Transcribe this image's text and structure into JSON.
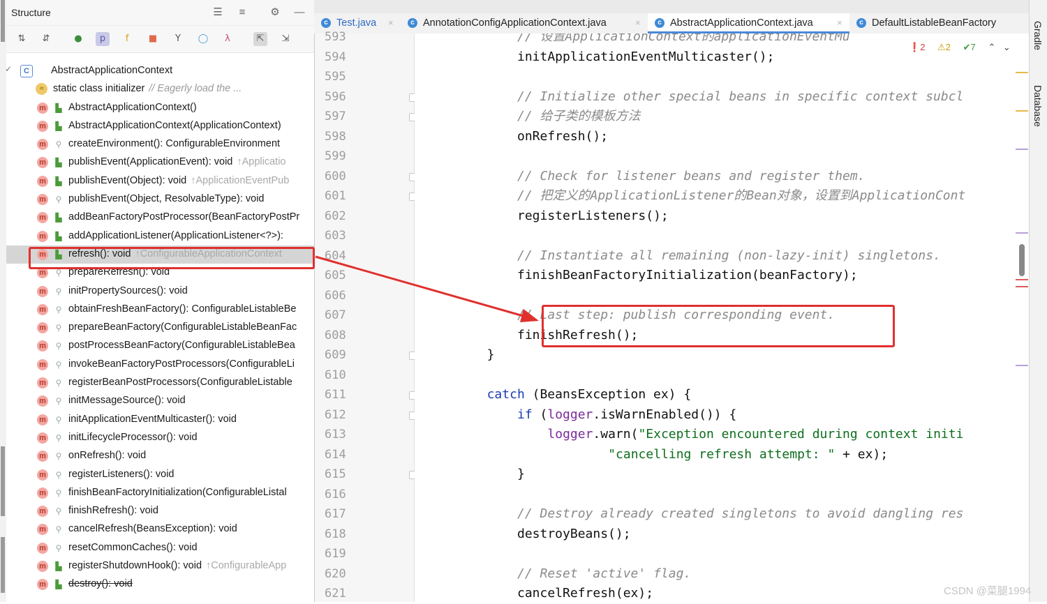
{
  "structure": {
    "title": "Structure",
    "root": "AbstractApplicationContext",
    "items": [
      {
        "badge": "",
        "text": "static class initializer",
        "hint": "// Eagerly load the ...",
        "kind": "init"
      },
      {
        "badge": "m",
        "text": "AbstractApplicationContext()",
        "hint": "",
        "kind": "pub"
      },
      {
        "badge": "m",
        "text": "AbstractApplicationContext(ApplicationContext)",
        "hint": "",
        "kind": "pub"
      },
      {
        "badge": "m",
        "text": "createEnvironment(): ConfigurableEnvironment",
        "hint": "",
        "kind": "prot"
      },
      {
        "badge": "m",
        "text": "publishEvent(ApplicationEvent): void",
        "hint": "↑Applicatio",
        "kind": "pub"
      },
      {
        "badge": "m",
        "text": "publishEvent(Object): void",
        "hint": "↑ApplicationEventPub",
        "kind": "pub"
      },
      {
        "badge": "m",
        "text": "publishEvent(Object, ResolvableType): void",
        "hint": "",
        "kind": "prot"
      },
      {
        "badge": "m",
        "text": "addBeanFactoryPostProcessor(BeanFactoryPostPr",
        "hint": "",
        "kind": "pub"
      },
      {
        "badge": "m",
        "text": "addApplicationListener(ApplicationListener<?>):",
        "hint": "",
        "kind": "pub"
      },
      {
        "badge": "m",
        "text": "refresh(): void",
        "hint": "↑ConfigurableApplicationContext",
        "kind": "pub",
        "selected": true
      },
      {
        "badge": "m",
        "text": "prepareRefresh(): void",
        "hint": "",
        "kind": "prot"
      },
      {
        "badge": "m",
        "text": "initPropertySources(): void",
        "hint": "",
        "kind": "prot"
      },
      {
        "badge": "m",
        "text": "obtainFreshBeanFactory(): ConfigurableListableBe",
        "hint": "",
        "kind": "prot"
      },
      {
        "badge": "m",
        "text": "prepareBeanFactory(ConfigurableListableBeanFac",
        "hint": "",
        "kind": "prot"
      },
      {
        "badge": "m",
        "text": "postProcessBeanFactory(ConfigurableListableBea",
        "hint": "",
        "kind": "prot"
      },
      {
        "badge": "m",
        "text": "invokeBeanFactoryPostProcessors(ConfigurableLi",
        "hint": "",
        "kind": "prot"
      },
      {
        "badge": "m",
        "text": "registerBeanPostProcessors(ConfigurableListable",
        "hint": "",
        "kind": "prot"
      },
      {
        "badge": "m",
        "text": "initMessageSource(): void",
        "hint": "",
        "kind": "prot"
      },
      {
        "badge": "m",
        "text": "initApplicationEventMulticaster(): void",
        "hint": "",
        "kind": "prot"
      },
      {
        "badge": "m",
        "text": "initLifecycleProcessor(): void",
        "hint": "",
        "kind": "prot"
      },
      {
        "badge": "m",
        "text": "onRefresh(): void",
        "hint": "",
        "kind": "prot"
      },
      {
        "badge": "m",
        "text": "registerListeners(): void",
        "hint": "",
        "kind": "prot"
      },
      {
        "badge": "m",
        "text": "finishBeanFactoryInitialization(ConfigurableListal",
        "hint": "",
        "kind": "prot"
      },
      {
        "badge": "m",
        "text": "finishRefresh(): void",
        "hint": "",
        "kind": "prot"
      },
      {
        "badge": "m",
        "text": "cancelRefresh(BeansException): void",
        "hint": "",
        "kind": "prot"
      },
      {
        "badge": "m",
        "text": "resetCommonCaches(): void",
        "hint": "",
        "kind": "prot"
      },
      {
        "badge": "m",
        "text": "registerShutdownHook(): void",
        "hint": "↑ConfigurableApp",
        "kind": "pub"
      },
      {
        "badge": "m",
        "text": "destroy(): void",
        "hint": "",
        "kind": "pub",
        "strike": true
      }
    ]
  },
  "tabs": [
    {
      "label": "Test.java",
      "active": false
    },
    {
      "label": "AnnotationConfigApplicationContext.java",
      "active": false
    },
    {
      "label": "AbstractApplicationContext.java",
      "active": true
    },
    {
      "label": "DefaultListableBeanFactory",
      "active": false
    }
  ],
  "inspections": {
    "errors": "2",
    "warnings": "2",
    "ok": "7"
  },
  "line_numbers": [
    "593",
    "594",
    "595",
    "596",
    "597",
    "598",
    "599",
    "600",
    "601",
    "602",
    "603",
    "604",
    "605",
    "606",
    "607",
    "608",
    "609",
    "610",
    "611",
    "612",
    "613",
    "614",
    "615",
    "616",
    "617",
    "618",
    "619",
    "620",
    "621"
  ],
  "code_lines": [
    {
      "indent": 4,
      "parts": [
        {
          "t": "c",
          "v": "// 设置ApplicationContext的applicationEventMu"
        }
      ]
    },
    {
      "indent": 4,
      "parts": [
        {
          "t": "n",
          "v": "initApplicationEventMulticaster();"
        }
      ]
    },
    {
      "indent": 0,
      "parts": []
    },
    {
      "indent": 4,
      "parts": [
        {
          "t": "c",
          "v": "// Initialize other special beans in specific context subcl"
        }
      ]
    },
    {
      "indent": 4,
      "parts": [
        {
          "t": "c",
          "v": "// 给子类的模板方法"
        }
      ]
    },
    {
      "indent": 4,
      "parts": [
        {
          "t": "n",
          "v": "onRefresh();"
        }
      ]
    },
    {
      "indent": 0,
      "parts": []
    },
    {
      "indent": 4,
      "parts": [
        {
          "t": "c",
          "v": "// Check for listener beans and register them."
        }
      ]
    },
    {
      "indent": 4,
      "parts": [
        {
          "t": "c",
          "v": "// 把定义的ApplicationListener的Bean对象，设置到ApplicationCont"
        }
      ]
    },
    {
      "indent": 4,
      "parts": [
        {
          "t": "n",
          "v": "registerListeners();"
        }
      ]
    },
    {
      "indent": 0,
      "parts": []
    },
    {
      "indent": 4,
      "parts": [
        {
          "t": "c",
          "v": "// Instantiate all remaining (non-lazy-init) singletons."
        }
      ]
    },
    {
      "indent": 4,
      "parts": [
        {
          "t": "n",
          "v": "finishBeanFactoryInitialization(beanFactory);"
        }
      ]
    },
    {
      "indent": 0,
      "parts": []
    },
    {
      "indent": 4,
      "parts": [
        {
          "t": "c",
          "v": "// Last step: publish corresponding event."
        }
      ]
    },
    {
      "indent": 4,
      "parts": [
        {
          "t": "n",
          "v": "finishRefresh();"
        }
      ]
    },
    {
      "indent": 0,
      "parts": [
        {
          "t": "n",
          "v": "}"
        }
      ]
    },
    {
      "indent": 0,
      "parts": []
    },
    {
      "indent": 0,
      "parts": [
        {
          "t": "k",
          "v": "catch"
        },
        {
          "t": "n",
          "v": " (BeansException ex) {"
        }
      ]
    },
    {
      "indent": 4,
      "parts": [
        {
          "t": "k",
          "v": "if"
        },
        {
          "t": "n",
          "v": " ("
        },
        {
          "t": "f",
          "v": "logger"
        },
        {
          "t": "n",
          "v": ".isWarnEnabled()) {"
        }
      ]
    },
    {
      "indent": 8,
      "parts": [
        {
          "t": "f",
          "v": "logger"
        },
        {
          "t": "n",
          "v": ".warn("
        },
        {
          "t": "s",
          "v": "\"Exception encountered during context initi"
        }
      ]
    },
    {
      "indent": 16,
      "parts": [
        {
          "t": "s",
          "v": "\"cancelling refresh attempt: \""
        },
        {
          "t": "n",
          "v": " + ex);"
        }
      ]
    },
    {
      "indent": 4,
      "parts": [
        {
          "t": "n",
          "v": "}"
        }
      ]
    },
    {
      "indent": 0,
      "parts": []
    },
    {
      "indent": 4,
      "parts": [
        {
          "t": "c",
          "v": "// Destroy already created singletons to avoid dangling res"
        }
      ]
    },
    {
      "indent": 4,
      "parts": [
        {
          "t": "n",
          "v": "destroyBeans();"
        }
      ]
    },
    {
      "indent": 0,
      "parts": []
    },
    {
      "indent": 4,
      "parts": [
        {
          "t": "c",
          "v": "// Reset 'active' flag."
        }
      ]
    },
    {
      "indent": 4,
      "parts": [
        {
          "t": "n",
          "v": "cancelRefresh(ex);"
        }
      ]
    }
  ],
  "right_tools": [
    "Gradle",
    "Database"
  ],
  "watermark": "CSDN @菜腿1994",
  "colors": {
    "accent": "#4a88d8",
    "highlight_box": "#e0302e",
    "arrow": "#e0302e"
  }
}
